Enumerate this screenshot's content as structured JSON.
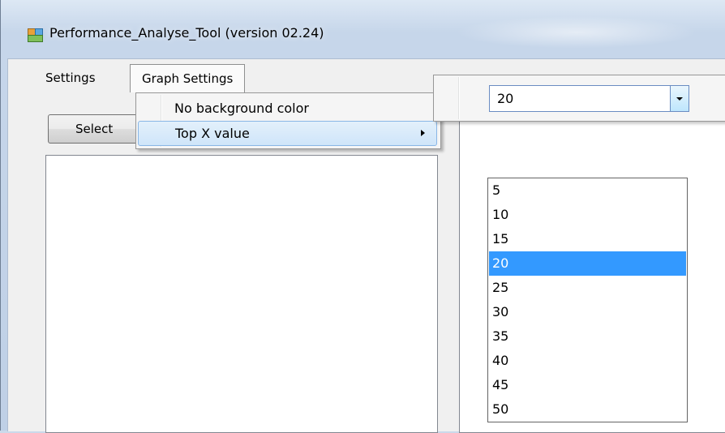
{
  "window": {
    "title": "Performance_Analyse_Tool (version 02.24)",
    "icon": "app-window-icon"
  },
  "menubar": {
    "items": [
      {
        "label": "Settings"
      },
      {
        "label": "Graph Settings"
      }
    ]
  },
  "select_button": {
    "label": "Select"
  },
  "graph_menu": {
    "items": [
      {
        "label": "No background color"
      },
      {
        "label": "Top X value",
        "icon": "submenu-arrow-icon"
      }
    ]
  },
  "top_x_combo": {
    "value": "20",
    "options": [
      "5",
      "10",
      "15",
      "20",
      "25",
      "30",
      "35",
      "40",
      "45",
      "50"
    ],
    "selected": "20",
    "icon": "chevron-down-icon"
  },
  "colors": {
    "selection": "#3399ff",
    "menu_hover": "#cfe5f9"
  }
}
